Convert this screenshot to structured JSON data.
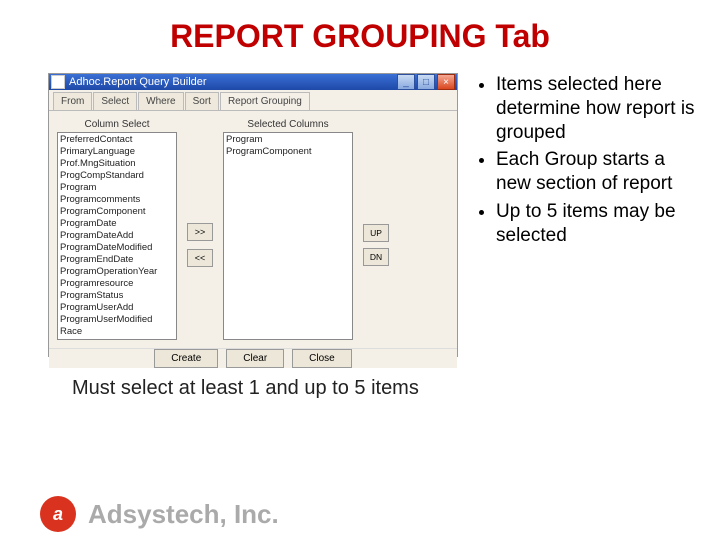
{
  "title": "REPORT GROUPING Tab",
  "window": {
    "title": "Adhoc.Report Query Builder",
    "tabs": {
      "t0": "From",
      "t1": "Select",
      "t2": "Where",
      "t3": "Sort",
      "t4": "Report Grouping"
    },
    "column_select_label": "Column Select",
    "selected_columns_label": "Selected Columns",
    "available": {
      "i0": "PreferredContact",
      "i1": "PrimaryLanguage",
      "i2": "Prof.MngSituation",
      "i3": "ProgCompStandard",
      "i4": "Program",
      "i5": "Programcomments",
      "i6": "ProgramComponent",
      "i7": "ProgramDate",
      "i8": "ProgramDateAdd",
      "i9": "ProgramDateModified",
      "i10": "ProgramEndDate",
      "i11": "ProgramOperationYear",
      "i12": "Programresource",
      "i13": "ProgramStatus",
      "i14": "ProgramUserAdd",
      "i15": "ProgramUserModified",
      "i16": "Race"
    },
    "selected": {
      "i0": "Program",
      "i1": "ProgramComponent"
    },
    "move_right": ">>",
    "move_left": "<<",
    "up": "UP",
    "dn": "DN",
    "bottom": {
      "b0": "Create",
      "b1": "Clear",
      "b2": "Close"
    }
  },
  "bullets": {
    "b0": "Items selected here determine how report is grouped",
    "b1": "Each Group starts a new section of report",
    "b2": "Up to 5 items may be selected"
  },
  "caption": "Must select at least 1 and up to 5 items",
  "footer": {
    "company": "Adsystech, Inc."
  }
}
